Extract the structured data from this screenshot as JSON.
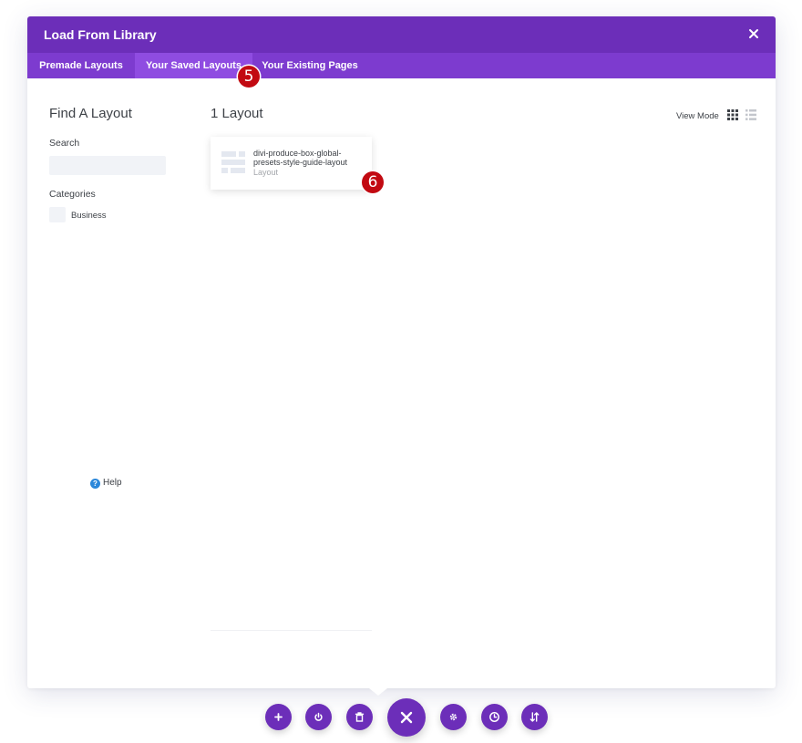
{
  "modal": {
    "title": "Load From Library",
    "tabs": [
      {
        "label": "Premade Layouts",
        "active": false
      },
      {
        "label": "Your Saved Layouts",
        "active": true
      },
      {
        "label": "Your Existing Pages",
        "active": false
      }
    ]
  },
  "annotations": {
    "step_5": "5",
    "step_6": "6"
  },
  "sidebar": {
    "title": "Find A Layout",
    "search_label": "Search",
    "search_value": "",
    "categories_label": "Categories",
    "categories": [
      {
        "label": "Business",
        "checked": false
      }
    ],
    "help_label": "Help"
  },
  "results": {
    "title": "1 Layout",
    "view_mode_label": "View Mode",
    "view_mode": "grid",
    "items": [
      {
        "name": "divi-produce-box-global-presets-style-guide-layout",
        "type": "Layout"
      }
    ]
  },
  "toolbar": {
    "buttons": [
      "plus-icon",
      "power-icon",
      "trash-icon",
      "close-icon",
      "gear-icon",
      "history-icon",
      "sort-icon"
    ]
  },
  "colors": {
    "header": "#6c2eb9",
    "tabs_bar": "#7d3bcf",
    "active_tab": "#8f4ce1",
    "badge": "#c20a12",
    "help_icon": "#2b87da"
  }
}
